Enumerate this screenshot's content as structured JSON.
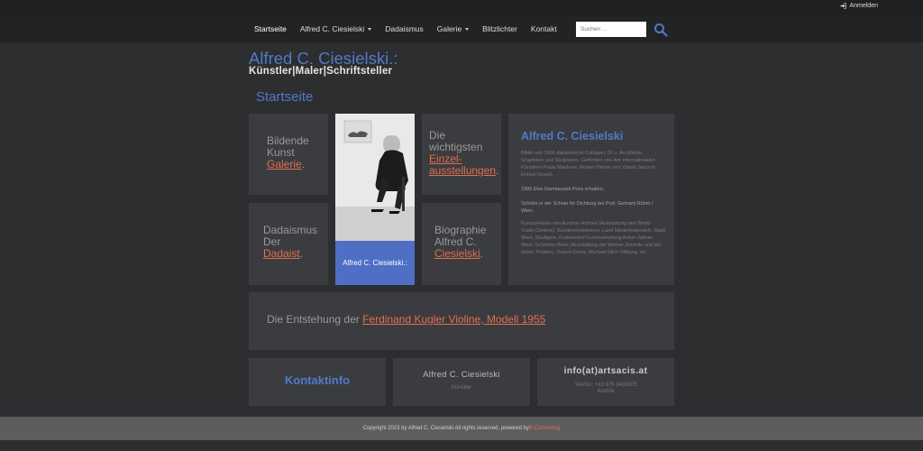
{
  "topbar": {
    "login_label": "Anmelden"
  },
  "nav": {
    "items": [
      {
        "label": "Startseite"
      },
      {
        "label": "Alfred C. Ciesielski"
      },
      {
        "label": "Dadaismus"
      },
      {
        "label": "Galerie"
      },
      {
        "label": "Blitzlichter"
      },
      {
        "label": "Kontakt"
      }
    ]
  },
  "search": {
    "placeholder": "Suchen ..."
  },
  "header": {
    "title": "Alfred C. Ciesielski.:",
    "subtitle": "Künstler|Maler|Schriftsteller"
  },
  "page": {
    "heading": "Startseite"
  },
  "tiles": {
    "kunst": {
      "line1": "Bildende",
      "line2": "Kunst",
      "link": "Galerie",
      "dot": "."
    },
    "dada": {
      "line1": "Dadaismus",
      "line2": "Der",
      "link": "Dadaist",
      "dot": "."
    },
    "ausstellungen": {
      "line1": "Die",
      "line2": "wichtigsten",
      "link1": "Einzel-",
      "link2": "ausstellungen",
      "dot": "."
    },
    "biographie": {
      "line1": "Biographie",
      "line2": "Alfred C.",
      "link": "Ciesielski",
      "dot": "."
    },
    "photo_caption": "Alfred C. Ciesielski.:"
  },
  "bio": {
    "title": "Alfred C. Ciesielski",
    "p1": "Bildet seit 1966 dadaistische Collagen, Öl u. Acrylbilder, Graphiken und Skulpturen. Gefördert von den internationalen Künstlern Paula Mauterer, Robert Pleiser und Vlasol Janco in Enhod (Israel).",
    "p2": "1989 Else Rambausek Preis erhalten.",
    "p3": "Schüler in der Schule für Dichtung bei Prof. Gerhard Rühm / Wien.",
    "p4": "Kunstankäufe von Austrian Airlines (Ausstattung des World-Trade-Centers), Bundesministerium, Land Niederösterreich, Stadt Wien, Stadtgem. Purkersdorf Kunstsammlung Anton-Jattner-Wien, Schoeller-Bank (Ausstattung der Wiener Zentrale und der österr. Filialen), Dulsch-Druck, Michael-Stich-Stiftung, etc."
  },
  "violin": {
    "prefix": "Die Entstehung der ",
    "link": "Ferdinand Kugler Violine, Modell 1955"
  },
  "contact": {
    "title": "Kontaktinfo",
    "name": "Alfred C. Ciesielski",
    "role": "Künstler",
    "email": "info(at)artsacis.at",
    "phone": "Telefon: +43 676 3493005",
    "country": "Austria"
  },
  "footer": {
    "text": "Copyright 2023 by Alfred C. Ciesielski All rights reserved, powered by ",
    "link": "B-Consulting"
  },
  "colors": {
    "accent_blue": "#5379c7",
    "link_orange": "#e06f4f",
    "tile_bg": "#3b3c3f",
    "page_bg": "#2d2e30"
  }
}
